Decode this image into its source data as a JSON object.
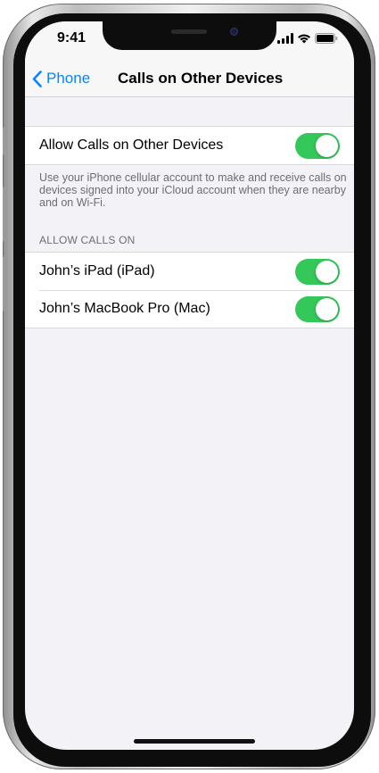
{
  "status_bar": {
    "time": "9:41",
    "icons": [
      "signal-icon",
      "wifi-icon",
      "battery-icon"
    ]
  },
  "nav": {
    "back_label": "Phone",
    "title": "Calls on Other Devices",
    "accent_color": "#0a84ff"
  },
  "main_setting": {
    "label": "Allow Calls on Other Devices",
    "enabled": true
  },
  "description": "Use your iPhone cellular account to make and receive calls on devices signed into your iCloud account when they are nearby and on Wi-Fi.",
  "devices_section": {
    "header": "ALLOW CALLS ON",
    "devices": [
      {
        "label": "John’s iPad (iPad)",
        "enabled": true
      },
      {
        "label": "John’s MacBook Pro (Mac)",
        "enabled": true
      }
    ]
  },
  "colors": {
    "toggle_on": "#34c759",
    "background": "#f2f2f7"
  }
}
